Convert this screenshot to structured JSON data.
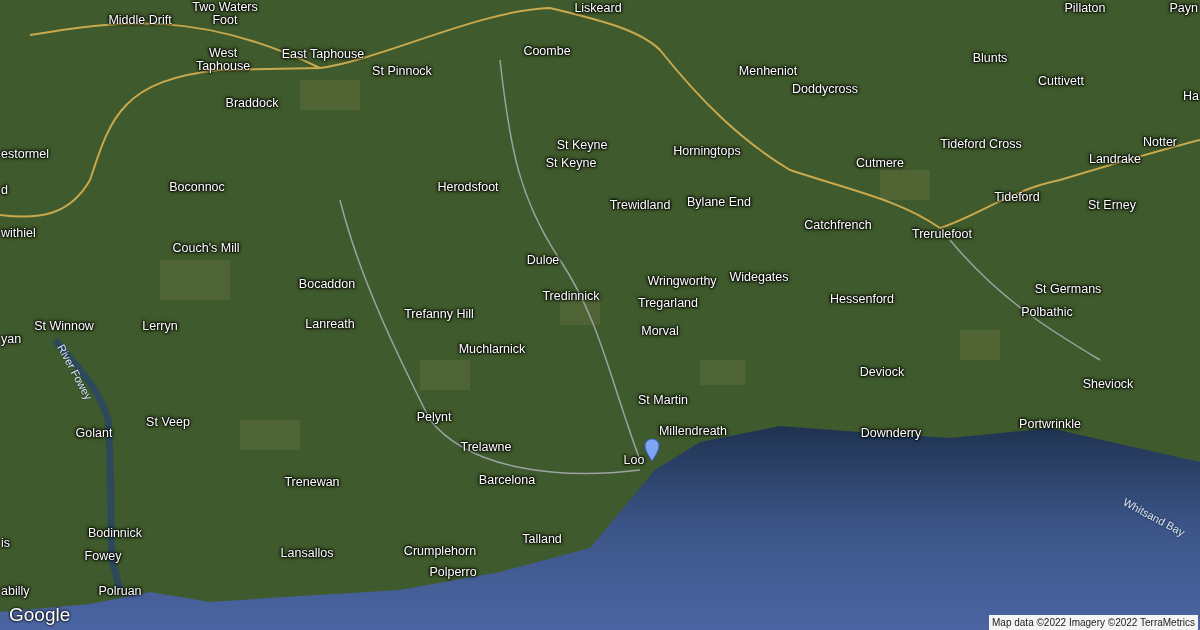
{
  "map": {
    "places": [
      {
        "name": "Middle Drift"
      },
      {
        "name": "Two Waters Foot"
      },
      {
        "name": "West Taphouse"
      },
      {
        "name": "East Taphouse"
      },
      {
        "name": "St Pinnock"
      },
      {
        "name": "Braddock"
      },
      {
        "name": "Liskeard"
      },
      {
        "name": "Coombe"
      },
      {
        "name": "Menheniot"
      },
      {
        "name": "Doddycross"
      },
      {
        "name": "Blunts"
      },
      {
        "name": "Cuttivett"
      },
      {
        "name": "Pillaton"
      },
      {
        "name": "Payn"
      },
      {
        "name": "Ha"
      },
      {
        "name": "estormel"
      },
      {
        "name": "d"
      },
      {
        "name": "withiel"
      },
      {
        "name": "Boconnoc"
      },
      {
        "name": "Herodsfoot"
      },
      {
        "name": "St Keyne"
      },
      {
        "name": "St Keyne"
      },
      {
        "name": "Horningtops"
      },
      {
        "name": "Tideford Cross"
      },
      {
        "name": "Notter"
      },
      {
        "name": "Landrake"
      },
      {
        "name": "Cutmere"
      },
      {
        "name": "Trewidland"
      },
      {
        "name": "Bylane End"
      },
      {
        "name": "Tideford"
      },
      {
        "name": "St Erney"
      },
      {
        "name": "Catchfrench"
      },
      {
        "name": "Trerulefoot"
      },
      {
        "name": "Couch's Mill"
      },
      {
        "name": "Duloe"
      },
      {
        "name": "Wringworthy"
      },
      {
        "name": "Widegates"
      },
      {
        "name": "Bocaddon"
      },
      {
        "name": "Tredinnick"
      },
      {
        "name": "Tregarland"
      },
      {
        "name": "Hessenford"
      },
      {
        "name": "St Germans"
      },
      {
        "name": "Lanreath"
      },
      {
        "name": "Trefanny Hill"
      },
      {
        "name": "Polbathic"
      },
      {
        "name": "St Winnow"
      },
      {
        "name": "Lerryn"
      },
      {
        "name": "yan"
      },
      {
        "name": "Morval"
      },
      {
        "name": "Muchlarnick"
      },
      {
        "name": "Deviock"
      },
      {
        "name": "Sheviock"
      },
      {
        "name": "St Martin"
      },
      {
        "name": "Pelynt"
      },
      {
        "name": "St Veep"
      },
      {
        "name": "Golant"
      },
      {
        "name": "Millendreath"
      },
      {
        "name": "Downderry"
      },
      {
        "name": "Portwrinkle"
      },
      {
        "name": "Trelawne"
      },
      {
        "name": "Loo"
      },
      {
        "name": "Trenewan"
      },
      {
        "name": "Barcelona"
      },
      {
        "name": "Bodinnick"
      },
      {
        "name": "is"
      },
      {
        "name": "Talland"
      },
      {
        "name": "Fowey"
      },
      {
        "name": "Lansallos"
      },
      {
        "name": "Crumplehorn"
      },
      {
        "name": "Polperro"
      },
      {
        "name": "abilly"
      },
      {
        "name": "Polruan"
      }
    ],
    "water_labels": [
      {
        "name": "River Fowey"
      },
      {
        "name": "Whitsand Bay"
      }
    ],
    "logo": "Google",
    "attribution": "Map data ©2022 Imagery ©2022 TerraMetrics"
  }
}
